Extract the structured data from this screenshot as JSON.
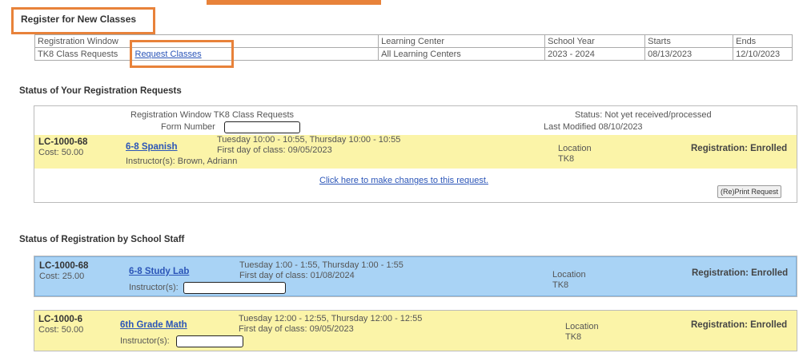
{
  "page": {
    "title": "Register for New Classes"
  },
  "registration_window": {
    "headers": [
      "Registration Window",
      "Learning Center",
      "School Year",
      "Starts",
      "Ends"
    ],
    "row": {
      "window": "TK8 Class Requests",
      "link": "Request Classes",
      "center": "All Learning Centers",
      "year": "2023 - 2024",
      "starts": "08/13/2023",
      "ends": "12/10/2023"
    }
  },
  "requests": {
    "title": "Status of Your Registration Requests",
    "window_label": "Registration Window",
    "window_value": "TK8 Class Requests",
    "form_label": "Form Number",
    "status_label": "Status",
    "status_value": "Not yet received/processed",
    "modified_label": "Last Modified",
    "modified_value": "08/10/2023",
    "change_link": "Click here to make changes to this request.",
    "reprint_button": "(Re)Print Request",
    "item": {
      "code": "LC-1000-68",
      "cost": "Cost: 50.00",
      "class_name": "6-8 Spanish",
      "schedule": "Tuesday 10:00 - 10:55, Thursday 10:00 - 10:55",
      "first_day": "First day of class: 09/05/2023",
      "instructor": "Instructor(s): Brown, Adriann",
      "location_label": "Location",
      "location_value": "TK8",
      "registration": "Registration: Enrolled"
    }
  },
  "staff": {
    "title": "Status of Registration by School Staff",
    "items": [
      {
        "code": "LC-1000-68",
        "cost": "Cost: 25.00",
        "class_name": "6-8 Study Lab",
        "schedule": "Tuesday 1:00 - 1:55, Thursday 1:00 - 1:55",
        "first_day": "First day of class: 01/08/2024",
        "instructor_label": "Instructor(s):",
        "location_label": "Location",
        "location_value": "TK8",
        "registration": "Registration: Enrolled"
      },
      {
        "code": "LC-1000-6",
        "cost": "Cost: 50.00",
        "class_name": "6th Grade Math",
        "schedule": "Tuesday 12:00 - 12:55, Thursday 12:00 - 12:55",
        "first_day": "First day of class: 09/05/2023",
        "instructor_label": "Instructor(s):",
        "location_label": "Location",
        "location_value": "TK8",
        "registration": "Registration: Enrolled"
      }
    ]
  },
  "colors": {
    "highlight": "#e8823a",
    "yellow_row": "#fbf4a8",
    "blue_row": "#a9d3f5",
    "link": "#2b55b8"
  }
}
